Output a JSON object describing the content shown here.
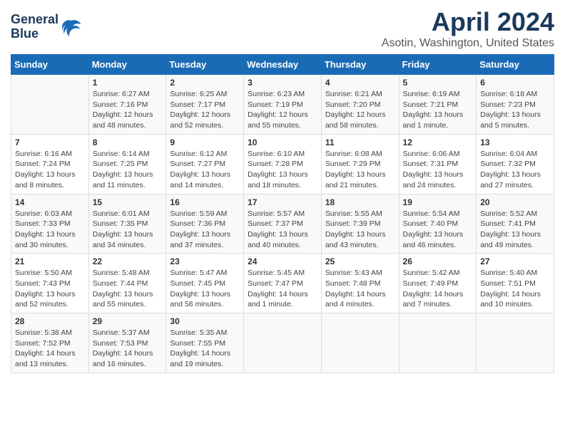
{
  "header": {
    "logo_line1": "General",
    "logo_line2": "Blue",
    "month": "April 2024",
    "location": "Asotin, Washington, United States"
  },
  "weekdays": [
    "Sunday",
    "Monday",
    "Tuesday",
    "Wednesday",
    "Thursday",
    "Friday",
    "Saturday"
  ],
  "weeks": [
    [
      {
        "day": "",
        "content": ""
      },
      {
        "day": "1",
        "content": "Sunrise: 6:27 AM\nSunset: 7:16 PM\nDaylight: 12 hours\nand 48 minutes."
      },
      {
        "day": "2",
        "content": "Sunrise: 6:25 AM\nSunset: 7:17 PM\nDaylight: 12 hours\nand 52 minutes."
      },
      {
        "day": "3",
        "content": "Sunrise: 6:23 AM\nSunset: 7:19 PM\nDaylight: 12 hours\nand 55 minutes."
      },
      {
        "day": "4",
        "content": "Sunrise: 6:21 AM\nSunset: 7:20 PM\nDaylight: 12 hours\nand 58 minutes."
      },
      {
        "day": "5",
        "content": "Sunrise: 6:19 AM\nSunset: 7:21 PM\nDaylight: 13 hours\nand 1 minute."
      },
      {
        "day": "6",
        "content": "Sunrise: 6:18 AM\nSunset: 7:23 PM\nDaylight: 13 hours\nand 5 minutes."
      }
    ],
    [
      {
        "day": "7",
        "content": "Sunrise: 6:16 AM\nSunset: 7:24 PM\nDaylight: 13 hours\nand 8 minutes."
      },
      {
        "day": "8",
        "content": "Sunrise: 6:14 AM\nSunset: 7:25 PM\nDaylight: 13 hours\nand 11 minutes."
      },
      {
        "day": "9",
        "content": "Sunrise: 6:12 AM\nSunset: 7:27 PM\nDaylight: 13 hours\nand 14 minutes."
      },
      {
        "day": "10",
        "content": "Sunrise: 6:10 AM\nSunset: 7:28 PM\nDaylight: 13 hours\nand 18 minutes."
      },
      {
        "day": "11",
        "content": "Sunrise: 6:08 AM\nSunset: 7:29 PM\nDaylight: 13 hours\nand 21 minutes."
      },
      {
        "day": "12",
        "content": "Sunrise: 6:06 AM\nSunset: 7:31 PM\nDaylight: 13 hours\nand 24 minutes."
      },
      {
        "day": "13",
        "content": "Sunrise: 6:04 AM\nSunset: 7:32 PM\nDaylight: 13 hours\nand 27 minutes."
      }
    ],
    [
      {
        "day": "14",
        "content": "Sunrise: 6:03 AM\nSunset: 7:33 PM\nDaylight: 13 hours\nand 30 minutes."
      },
      {
        "day": "15",
        "content": "Sunrise: 6:01 AM\nSunset: 7:35 PM\nDaylight: 13 hours\nand 34 minutes."
      },
      {
        "day": "16",
        "content": "Sunrise: 5:59 AM\nSunset: 7:36 PM\nDaylight: 13 hours\nand 37 minutes."
      },
      {
        "day": "17",
        "content": "Sunrise: 5:57 AM\nSunset: 7:37 PM\nDaylight: 13 hours\nand 40 minutes."
      },
      {
        "day": "18",
        "content": "Sunrise: 5:55 AM\nSunset: 7:39 PM\nDaylight: 13 hours\nand 43 minutes."
      },
      {
        "day": "19",
        "content": "Sunrise: 5:54 AM\nSunset: 7:40 PM\nDaylight: 13 hours\nand 46 minutes."
      },
      {
        "day": "20",
        "content": "Sunrise: 5:52 AM\nSunset: 7:41 PM\nDaylight: 13 hours\nand 49 minutes."
      }
    ],
    [
      {
        "day": "21",
        "content": "Sunrise: 5:50 AM\nSunset: 7:43 PM\nDaylight: 13 hours\nand 52 minutes."
      },
      {
        "day": "22",
        "content": "Sunrise: 5:48 AM\nSunset: 7:44 PM\nDaylight: 13 hours\nand 55 minutes."
      },
      {
        "day": "23",
        "content": "Sunrise: 5:47 AM\nSunset: 7:45 PM\nDaylight: 13 hours\nand 58 minutes."
      },
      {
        "day": "24",
        "content": "Sunrise: 5:45 AM\nSunset: 7:47 PM\nDaylight: 14 hours\nand 1 minute."
      },
      {
        "day": "25",
        "content": "Sunrise: 5:43 AM\nSunset: 7:48 PM\nDaylight: 14 hours\nand 4 minutes."
      },
      {
        "day": "26",
        "content": "Sunrise: 5:42 AM\nSunset: 7:49 PM\nDaylight: 14 hours\nand 7 minutes."
      },
      {
        "day": "27",
        "content": "Sunrise: 5:40 AM\nSunset: 7:51 PM\nDaylight: 14 hours\nand 10 minutes."
      }
    ],
    [
      {
        "day": "28",
        "content": "Sunrise: 5:38 AM\nSunset: 7:52 PM\nDaylight: 14 hours\nand 13 minutes."
      },
      {
        "day": "29",
        "content": "Sunrise: 5:37 AM\nSunset: 7:53 PM\nDaylight: 14 hours\nand 16 minutes."
      },
      {
        "day": "30",
        "content": "Sunrise: 5:35 AM\nSunset: 7:55 PM\nDaylight: 14 hours\nand 19 minutes."
      },
      {
        "day": "",
        "content": ""
      },
      {
        "day": "",
        "content": ""
      },
      {
        "day": "",
        "content": ""
      },
      {
        "day": "",
        "content": ""
      }
    ]
  ]
}
